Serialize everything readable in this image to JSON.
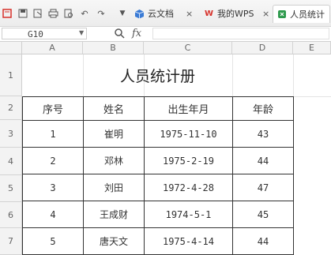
{
  "toolbar": {
    "tabs": [
      {
        "label": "云文档"
      },
      {
        "label": "我的WPS"
      },
      {
        "label": "人员统计"
      }
    ]
  },
  "formula_bar": {
    "cell_ref": "G10",
    "fx": "fx",
    "value": ""
  },
  "columns": [
    "A",
    "B",
    "C",
    "D",
    "E"
  ],
  "rows": [
    "1",
    "2",
    "3",
    "4",
    "5",
    "6",
    "7"
  ],
  "sheet": {
    "title": "人员统计册",
    "headers": [
      "序号",
      "姓名",
      "出生年月",
      "年龄"
    ],
    "records": [
      {
        "no": "1",
        "name": "崔明",
        "birth": "1975-11-10",
        "age": "43"
      },
      {
        "no": "2",
        "name": "邓林",
        "birth": "1975-2-19",
        "age": "44"
      },
      {
        "no": "3",
        "name": "刘田",
        "birth": "1972-4-28",
        "age": "47"
      },
      {
        "no": "4",
        "name": "王成财",
        "birth": "1974-5-1",
        "age": "45"
      },
      {
        "no": "5",
        "name": "唐天文",
        "birth": "1975-4-14",
        "age": "44"
      }
    ]
  },
  "colors": {
    "wps_red": "#d7312a",
    "cloud_blue": "#3a7bd5",
    "sheet_green": "#2e9a4d"
  }
}
